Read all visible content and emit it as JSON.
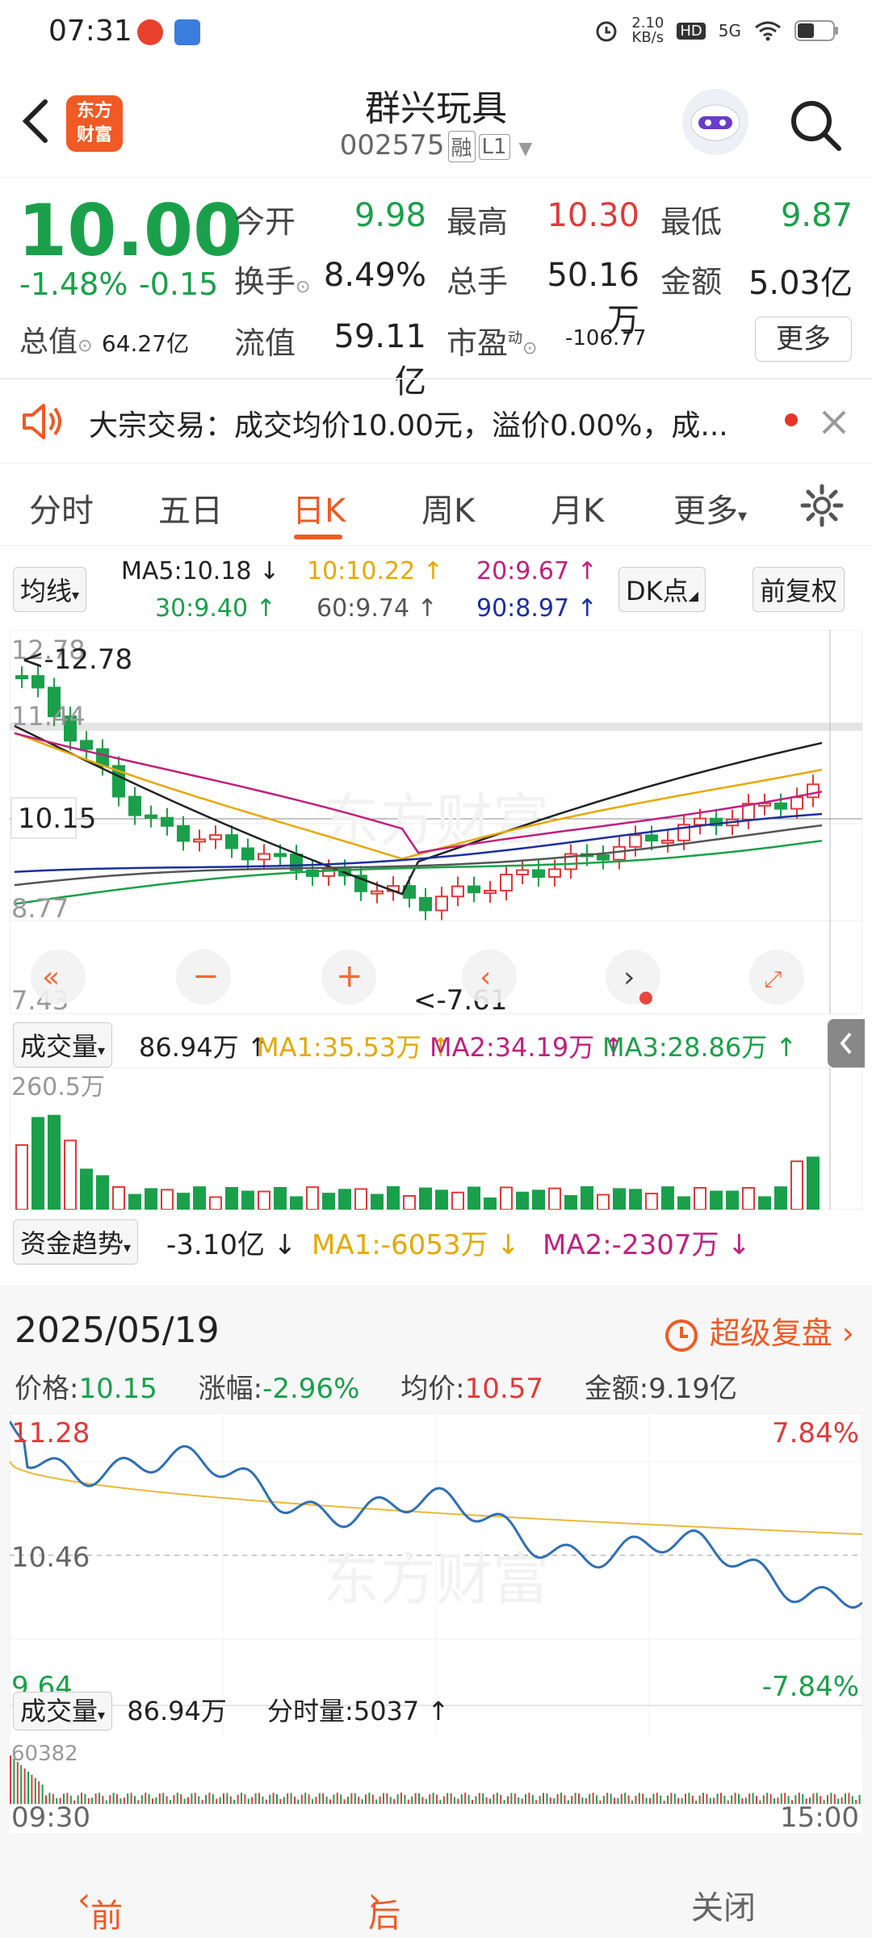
{
  "status": {
    "time": "07:31",
    "net_speed": "2.10\nKB/s",
    "net_label": "5G"
  },
  "header": {
    "name": "群兴玩具",
    "code": "002575",
    "tag1": "融",
    "tag2": "L1",
    "logo_line1": "东方",
    "logo_line2": "财富"
  },
  "quote": {
    "price": "10.00",
    "change_pct": "-1.48%",
    "change_abs": "-0.15",
    "open_label": "今开",
    "open": "9.98",
    "high_label": "最高",
    "high": "10.30",
    "low_label": "最低",
    "low": "9.87",
    "turnover_label": "换手",
    "turnover": "8.49%",
    "vol_label": "总手",
    "vol": "50.16万",
    "amount_label": "金额",
    "amount": "5.03亿",
    "mktcap_label": "总值",
    "mktcap": "64.27亿",
    "float_label": "流值",
    "float": "59.11亿",
    "pe_label": "市盈",
    "pe_sup": "动",
    "pe": "-106.77",
    "more": "更多"
  },
  "notice": {
    "text": "大宗交易：成交均价10.00元，溢价0.00%，成..."
  },
  "tabs": [
    {
      "label": "分时"
    },
    {
      "label": "五日"
    },
    {
      "label": "日K"
    },
    {
      "label": "周K"
    },
    {
      "label": "月K"
    },
    {
      "label": "更多"
    }
  ],
  "ma": {
    "selector": "均线",
    "ma5": "MA5:10.18 ↓",
    "ma10": "10:10.22 ↑",
    "ma20": "20:9.67 ↑",
    "ma30": "30:9.40 ↑",
    "ma60": "60:9.74 ↑",
    "ma90": "90:8.97 ↑",
    "dk": "DK点",
    "adjust": "前复权"
  },
  "kline": {
    "top_label": "12.78",
    "max_mark": "<-12.78",
    "mid_label": "11.44",
    "price_tag": "10.15",
    "low_label": "8.77",
    "bottom_label": "7.43",
    "min_mark": "<-7.61",
    "watermark": "东方财富"
  },
  "volume_row": {
    "selector": "成交量",
    "value": "86.94万 ↑",
    "ma1": "MA1:35.53万 ↑",
    "ma2": "MA2:34.19万 ↑",
    "ma3": "MA3:28.86万 ↑",
    "top_label": "260.5万"
  },
  "fund_row": {
    "selector": "资金趋势",
    "value": "-3.10亿 ↓",
    "ma1": "MA1:-6053万 ↓",
    "ma2": "MA2:-2307万 ↓"
  },
  "replay": {
    "date": "2025/05/19",
    "super": "超级复盘",
    "price_label": "价格:",
    "price": "10.15",
    "chg_label": "涨幅:",
    "chg": "-2.96%",
    "avg_label": "均价:",
    "avg": "10.57",
    "amt_label": "金额:",
    "amt": "9.19亿",
    "high": "11.28",
    "mid": "10.46",
    "low": "9.64",
    "high_pct": "7.84%",
    "low_pct": "-7.84%",
    "vol_selector": "成交量",
    "vol": "86.94万",
    "tick_label": "分时量:",
    "tick_vol": "5037 ↑",
    "vol_top": "60382",
    "time_start": "09:30",
    "time_end": "15:00",
    "prev": "前一天",
    "next": "后一天",
    "close": "关闭"
  },
  "colors": {
    "up": "#e03a3a",
    "down": "#1aa04a",
    "accent": "#f05a24"
  }
}
